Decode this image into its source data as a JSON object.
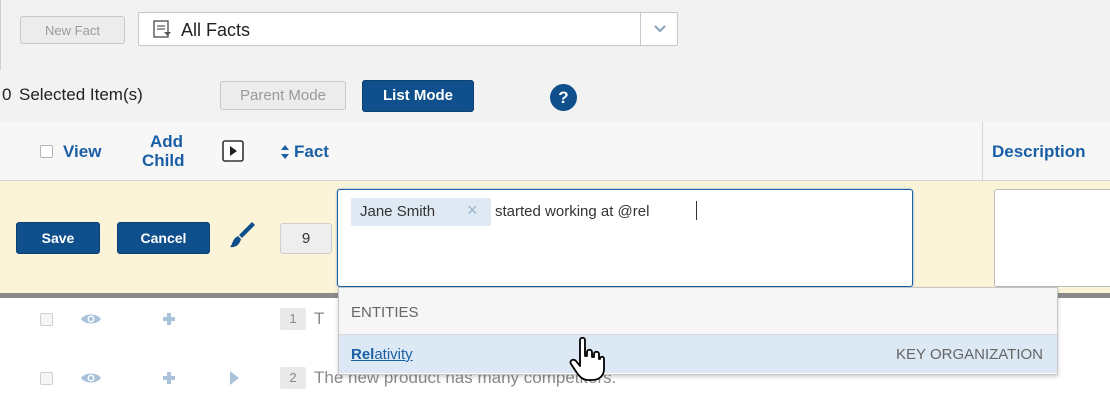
{
  "toolbar": {
    "new_fact_label": "New Fact",
    "view_select_value": "All Facts",
    "selected_count": "0",
    "selected_label": "Selected Item(s)",
    "parent_mode_label": "Parent Mode",
    "list_mode_label": "List Mode",
    "help_label": "?"
  },
  "columns": {
    "view": "View",
    "add_child_line1": "Add",
    "add_child_line2": "Child",
    "fact": "Fact",
    "description": "Description"
  },
  "edit_row": {
    "save_label": "Save",
    "cancel_label": "Cancel",
    "number": "9",
    "tag_label": "Jane Smith",
    "tag_remove": "×",
    "typed_text": "started working at @rel"
  },
  "rows": [
    {
      "number": "1",
      "text": "T"
    },
    {
      "number": "2",
      "text": "The new product has many competitors."
    }
  ],
  "autocomplete": {
    "section_label": "ENTITIES",
    "item_match": "Rel",
    "item_rest": "ativity",
    "item_type": "KEY ORGANIZATION"
  },
  "colors": {
    "accent": "#0e4f8c",
    "link": "#1a5fa6",
    "edit_row_bg": "#fbf4d9",
    "highlight": "#dce8f4"
  },
  "icons": [
    "dropdown-list-icon",
    "chevron-down-icon",
    "help-icon",
    "expand-play-icon",
    "sort-icon",
    "paintbrush-icon",
    "eye-icon",
    "plus-icon",
    "expand-arrow-icon",
    "hand-pointer-icon",
    "remove-tag-icon"
  ]
}
